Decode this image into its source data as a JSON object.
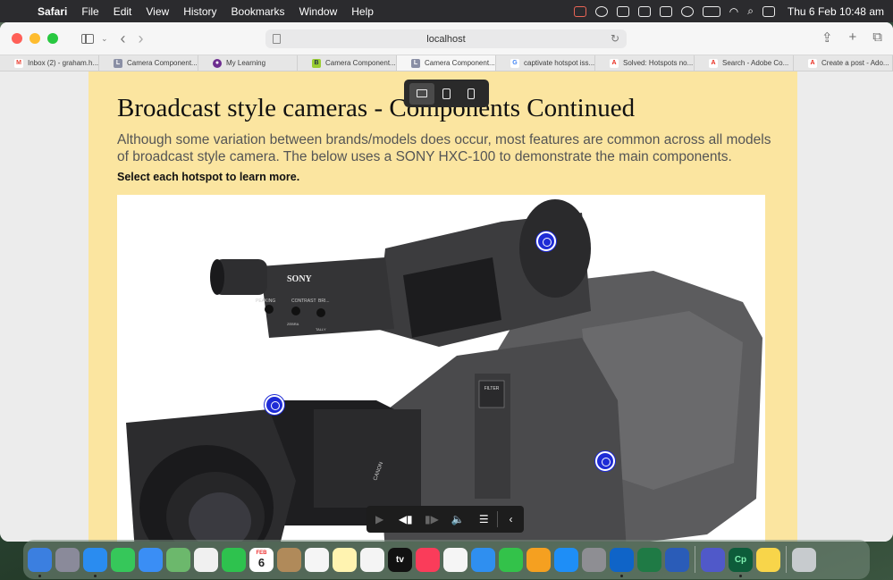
{
  "menubar": {
    "app_name": "Safari",
    "items": [
      "File",
      "Edit",
      "View",
      "History",
      "Bookmarks",
      "Window",
      "Help"
    ],
    "clock": "Thu 6 Feb  10:48 am"
  },
  "toolbar": {
    "url": "localhost"
  },
  "tabs": [
    {
      "label": "Inbox (2) - graham.h...",
      "favicon": "M",
      "color": "#ea4335"
    },
    {
      "label": "Camera Component...",
      "favicon": "L",
      "color": "#8a8fa5"
    },
    {
      "label": "My Learning",
      "favicon": "●",
      "color": "#6d2d8f"
    },
    {
      "label": "Camera Component...",
      "favicon": "B",
      "color": "#9acd32"
    },
    {
      "label": "Camera Component...",
      "favicon": "L",
      "color": "#8a8fa5"
    },
    {
      "label": "captivate hotspot iss...",
      "favicon": "G",
      "color": "#4285f4"
    },
    {
      "label": "Solved: Hotspots no...",
      "favicon": "A",
      "color": "#e8291c"
    },
    {
      "label": "Search - Adobe Co...",
      "favicon": "A",
      "color": "#e8291c"
    },
    {
      "label": "Create a post - Ado...",
      "favicon": "A",
      "color": "#e8291c"
    }
  ],
  "page": {
    "title": "Broadcast style cameras - Components Continued",
    "description": "Although some variation between brands/models does occur, most features are common across all models of broadcast style camera.  The below uses a SONY HXC-100 to demonstrate the main components.",
    "instruction": "Select each hotspot to learn more."
  },
  "camera_labels": {
    "brand": "SONY",
    "knob_1": "PEAKING",
    "knob_2": "CONTRAST",
    "knob_3": "BRI...",
    "sub_label": "ZEBRA",
    "tally": "TALLY",
    "filter_panel": "FILTER",
    "lens_brand": "CANON"
  },
  "colors": {
    "page_bg": "#fbe5a0",
    "hotspot": "#1e2bd6",
    "camera_body": "#5c5c5e"
  },
  "dock": {
    "calendar_month": "FEB",
    "calendar_day": "6",
    "tv_label": "tv",
    "cp_label": "Cp"
  }
}
